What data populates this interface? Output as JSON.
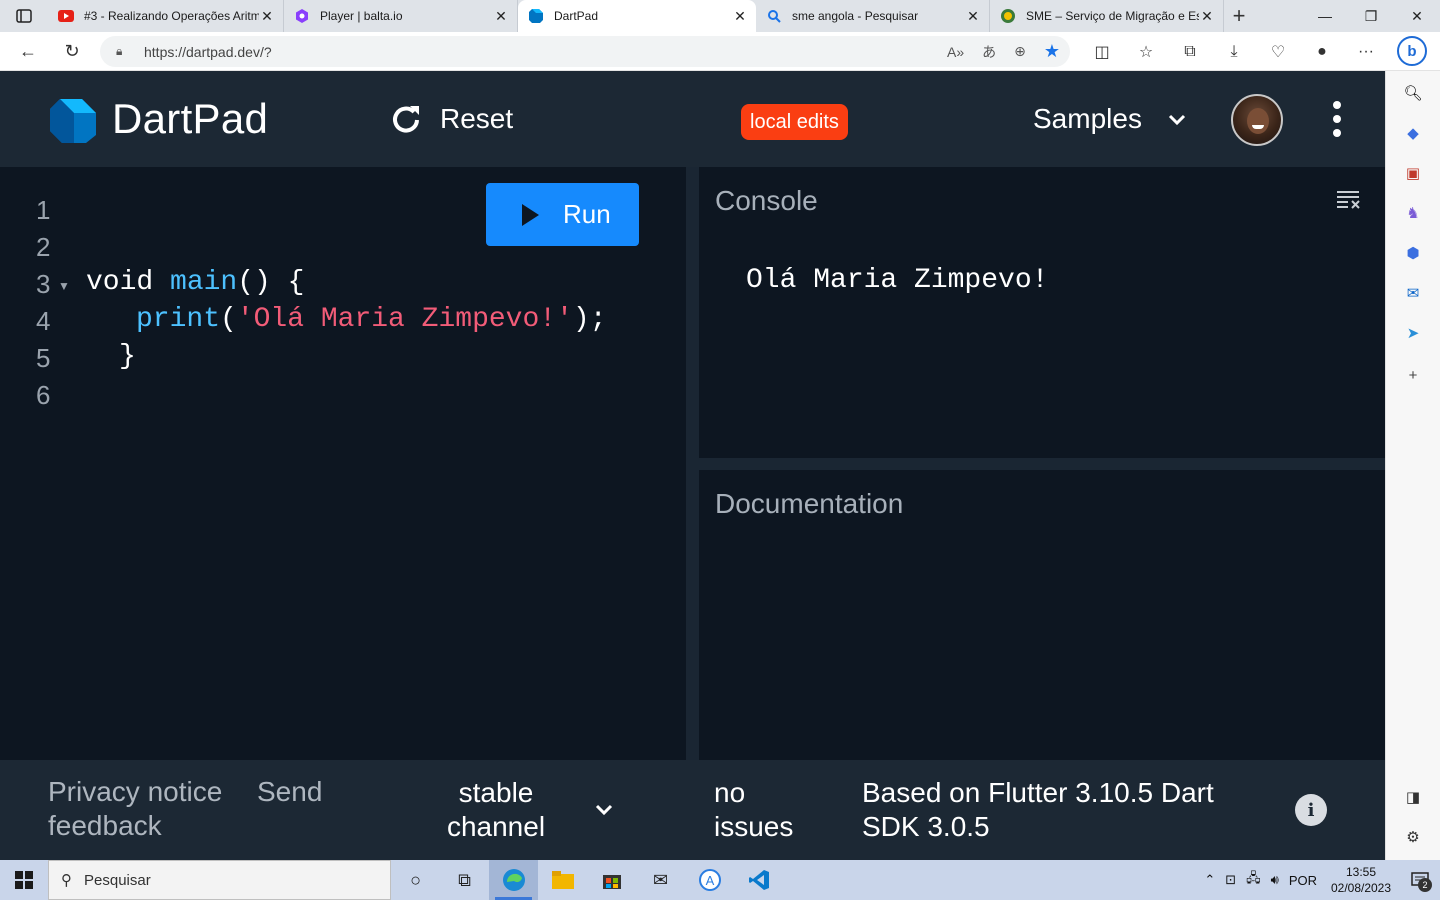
{
  "browser": {
    "tabs": [
      {
        "title": "#3 - Realizando Operações Aritm",
        "icon": "youtube-icon"
      },
      {
        "title": "Player | balta.io",
        "icon": "balta-icon"
      },
      {
        "title": "DartPad",
        "icon": "dart-icon",
        "active": true
      },
      {
        "title": "sme angola - Pesquisar",
        "icon": "search-icon"
      },
      {
        "title": "SME – Serviço de Migração e Est",
        "icon": "sme-icon"
      }
    ],
    "close_glyph": "✕",
    "url": "https://dartpad.dev/?"
  },
  "app": {
    "brand": "DartPad",
    "reset_label": "Reset",
    "badge_label": "local edits",
    "samples_label": "Samples",
    "run_label": "Run",
    "line_numbers": [
      "1",
      "2",
      "3",
      "4",
      "5",
      "6"
    ],
    "code": {
      "line3_kw": "void ",
      "line3_fn": "main",
      "line3_rest": "() {",
      "line4_fn": "print",
      "line4_open": "(",
      "line4_str": "'Olá Maria Zimpevo!'",
      "line4_close": ");",
      "line5": "}"
    },
    "console_title": "Console",
    "console_output": "Olá Maria Zimpevo!",
    "docs_title": "Documentation"
  },
  "footer": {
    "privacy": "Privacy notice",
    "send": "Send",
    "feedback": "feedback",
    "channel": "stable channel",
    "issues": "no issues",
    "sdk": "Based on Flutter 3.10.5 Dart SDK 3.0.5",
    "info_glyph": "i"
  },
  "taskbar": {
    "search_placeholder": "Pesquisar",
    "lang": "POR",
    "time": "13:55",
    "date": "02/08/2023",
    "notifications": "2"
  },
  "colors": {
    "accent_run": "#168afd",
    "badge": "#fa3e12",
    "header_bg": "#1c2834",
    "editor_bg": "#0d1621",
    "fn_color": "#4dc1ff",
    "string_color": "#f25c78"
  }
}
